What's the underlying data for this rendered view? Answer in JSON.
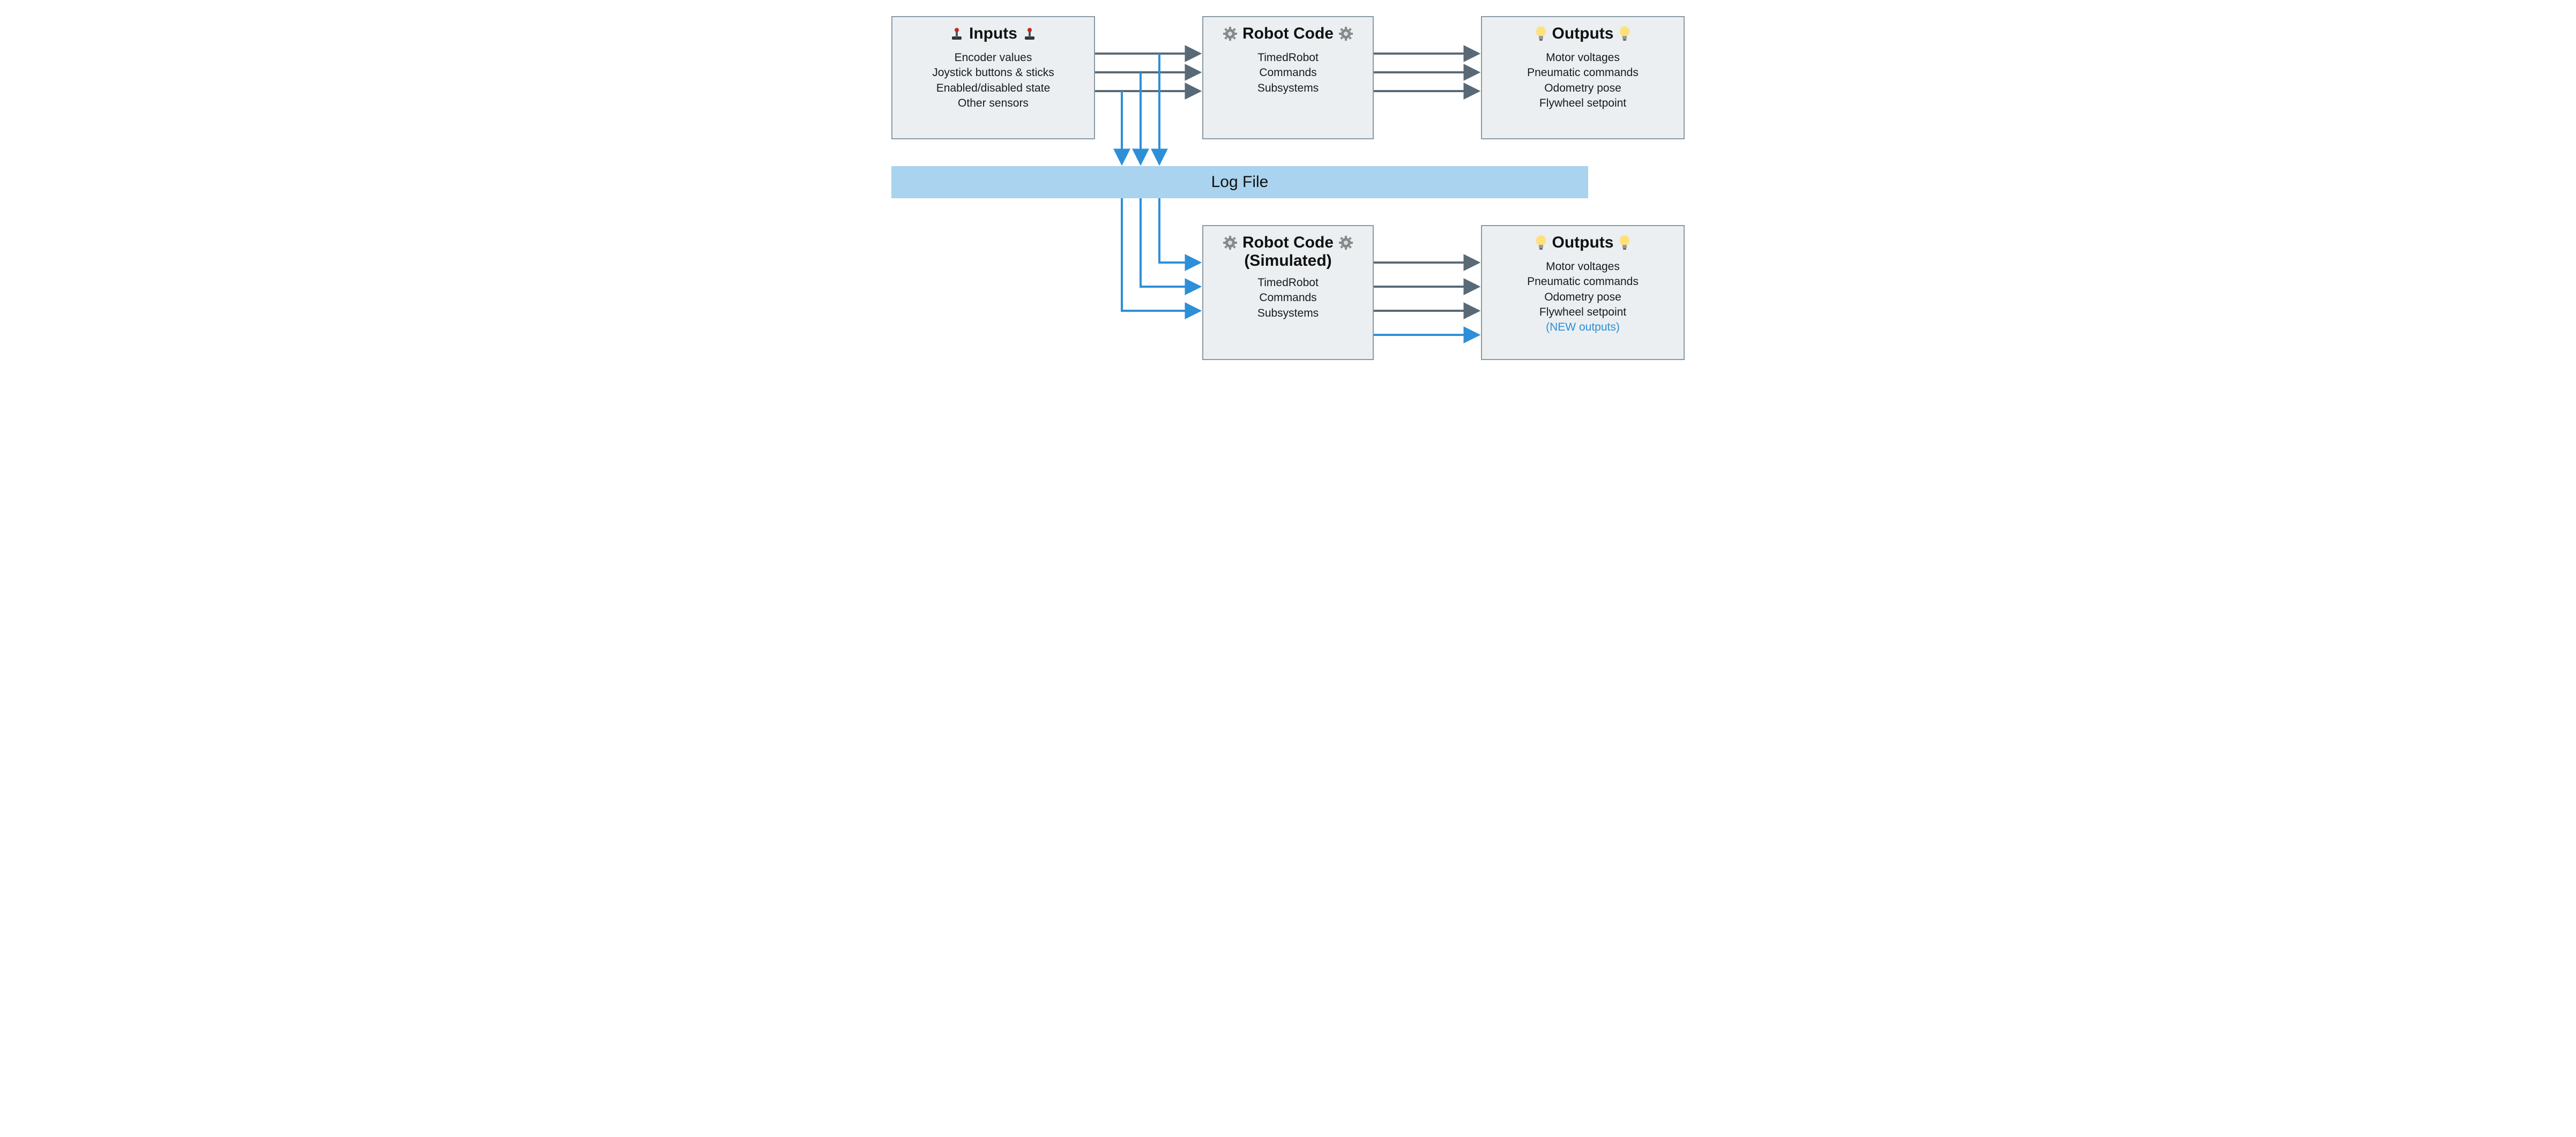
{
  "boxes": {
    "inputs": {
      "title": "Inputs",
      "icon": "joystick-icon",
      "items": [
        "Encoder values",
        "Joystick buttons & sticks",
        "Enabled/disabled state",
        "Other sensors"
      ]
    },
    "robot_code": {
      "title": "Robot Code",
      "icon": "gear-icon",
      "items": [
        "TimedRobot",
        "Commands",
        "Subsystems"
      ]
    },
    "outputs_top": {
      "title": "Outputs",
      "icon": "bulb-icon",
      "items": [
        "Motor voltages",
        "Pneumatic commands",
        "Odometry pose",
        "Flywheel setpoint"
      ]
    },
    "robot_code_sim": {
      "title_line1": "Robot Code",
      "title_line2": "(Simulated)",
      "icon": "gear-icon",
      "items": [
        "TimedRobot",
        "Commands",
        "Subsystems"
      ]
    },
    "outputs_bottom": {
      "title": "Outputs",
      "icon": "bulb-icon",
      "items": [
        "Motor voltages",
        "Pneumatic commands",
        "Odometry pose",
        "Flywheel setpoint",
        "(NEW outputs)"
      ],
      "accent_index": 4
    }
  },
  "logfile": {
    "label": "Log File"
  },
  "colors": {
    "box_fill": "#ebeff1",
    "box_border": "#8a9aa5",
    "arrow_gray": "#596a76",
    "arrow_blue": "#2d8fd8",
    "logbar": "#a9d3ee",
    "accent_text": "#2d8fd8"
  }
}
